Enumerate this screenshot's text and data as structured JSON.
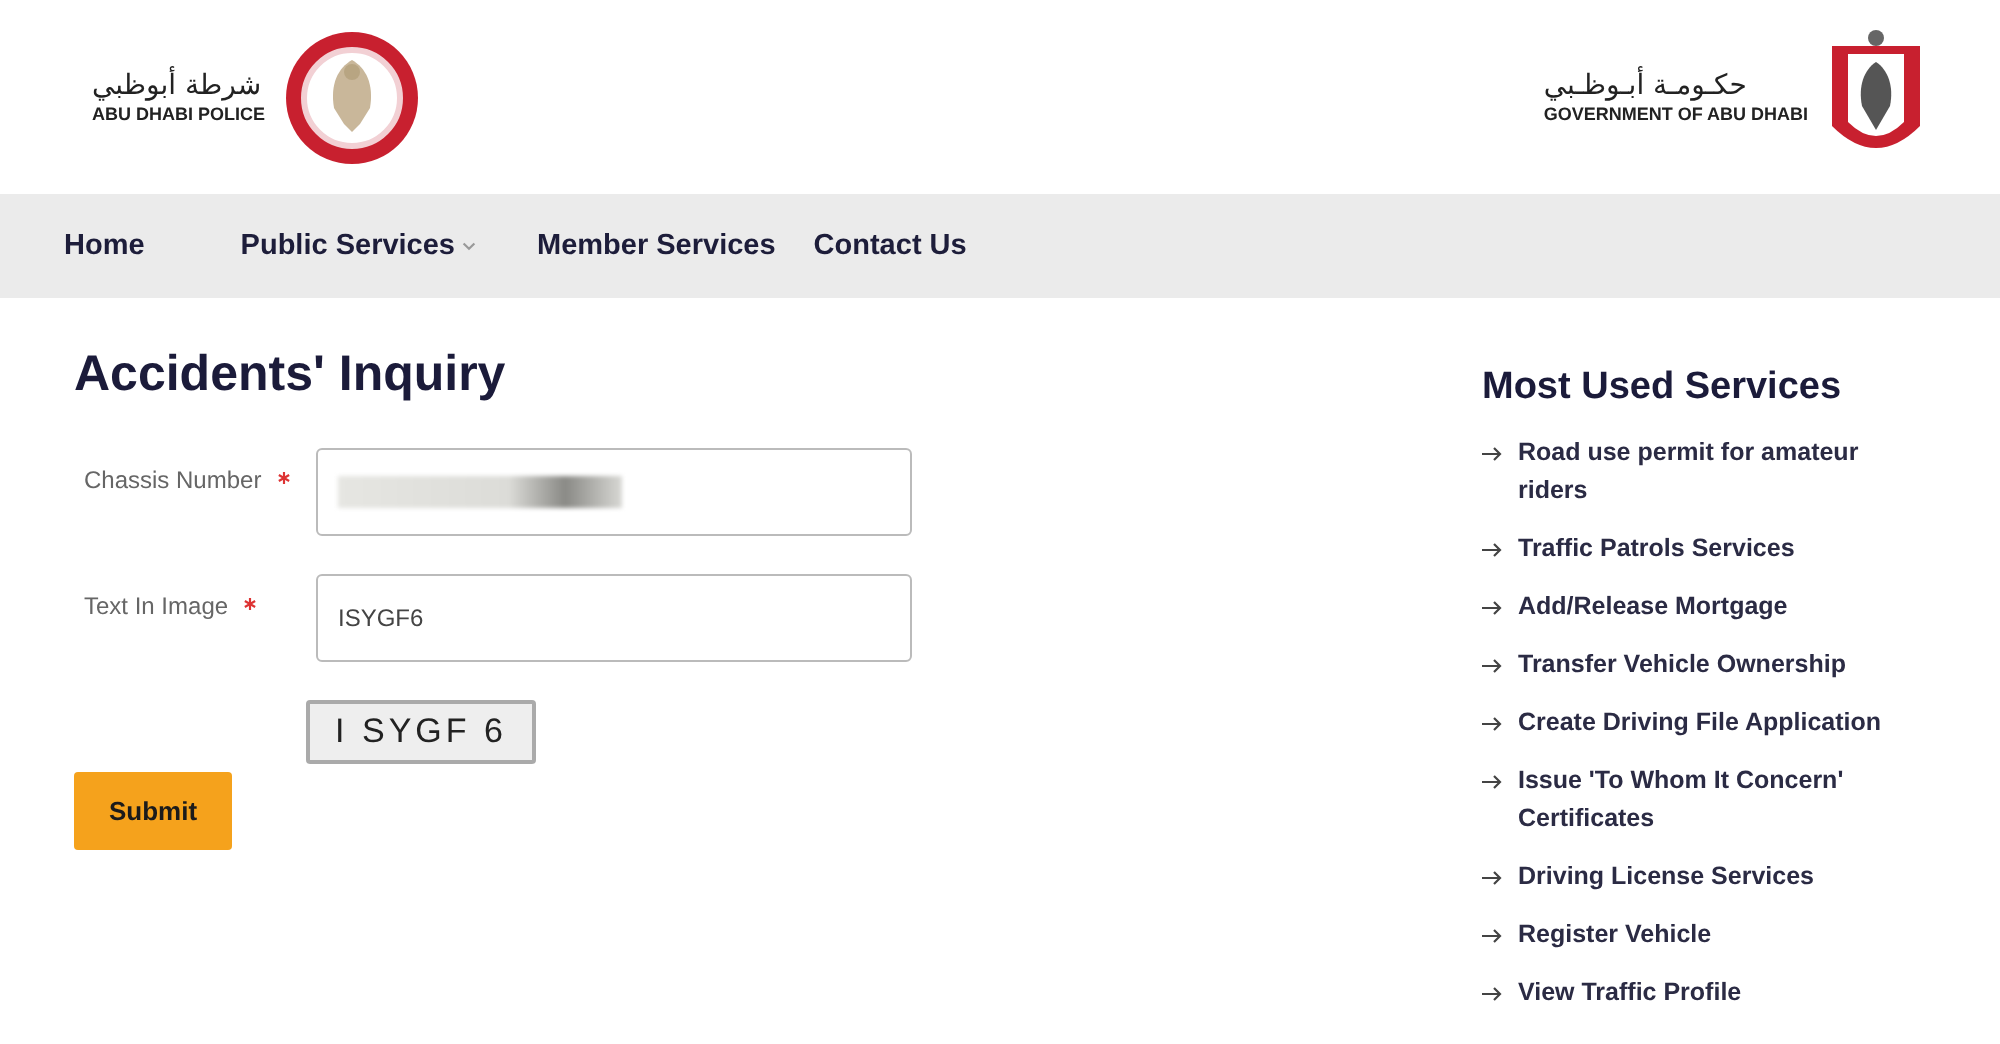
{
  "header": {
    "police_logo": {
      "arabic": "شرطة أبوظبي",
      "english": "ABU DHABI POLICE"
    },
    "government_logo": {
      "arabic": "حكـومـة أبـوظـبي",
      "english": "GOVERNMENT OF ABU DHABI"
    }
  },
  "nav": [
    {
      "label": "Home",
      "has_dropdown": false
    },
    {
      "label": "Public Services",
      "has_dropdown": true
    },
    {
      "label": "Member Services",
      "has_dropdown": false
    },
    {
      "label": "Contact Us",
      "has_dropdown": false
    }
  ],
  "form": {
    "title": "Accidents' Inquiry",
    "fields": [
      {
        "label": "Chassis Number",
        "required": true,
        "redacted": true
      },
      {
        "label": "Text In Image",
        "required": true,
        "value": "ISYGF6",
        "redacted": false
      }
    ],
    "captcha": "I SYGF 6",
    "submit": "Submit"
  },
  "sidebar": {
    "title": "Most Used Services",
    "links": [
      "Road use permit for amateur riders",
      "Traffic Patrols Services",
      "Add/Release Mortgage",
      "Transfer Vehicle Ownership",
      "Create Driving File Application",
      "Issue 'To Whom It Concern' Certificates",
      "Driving License Services",
      "Register Vehicle",
      "View Traffic Profile"
    ]
  }
}
